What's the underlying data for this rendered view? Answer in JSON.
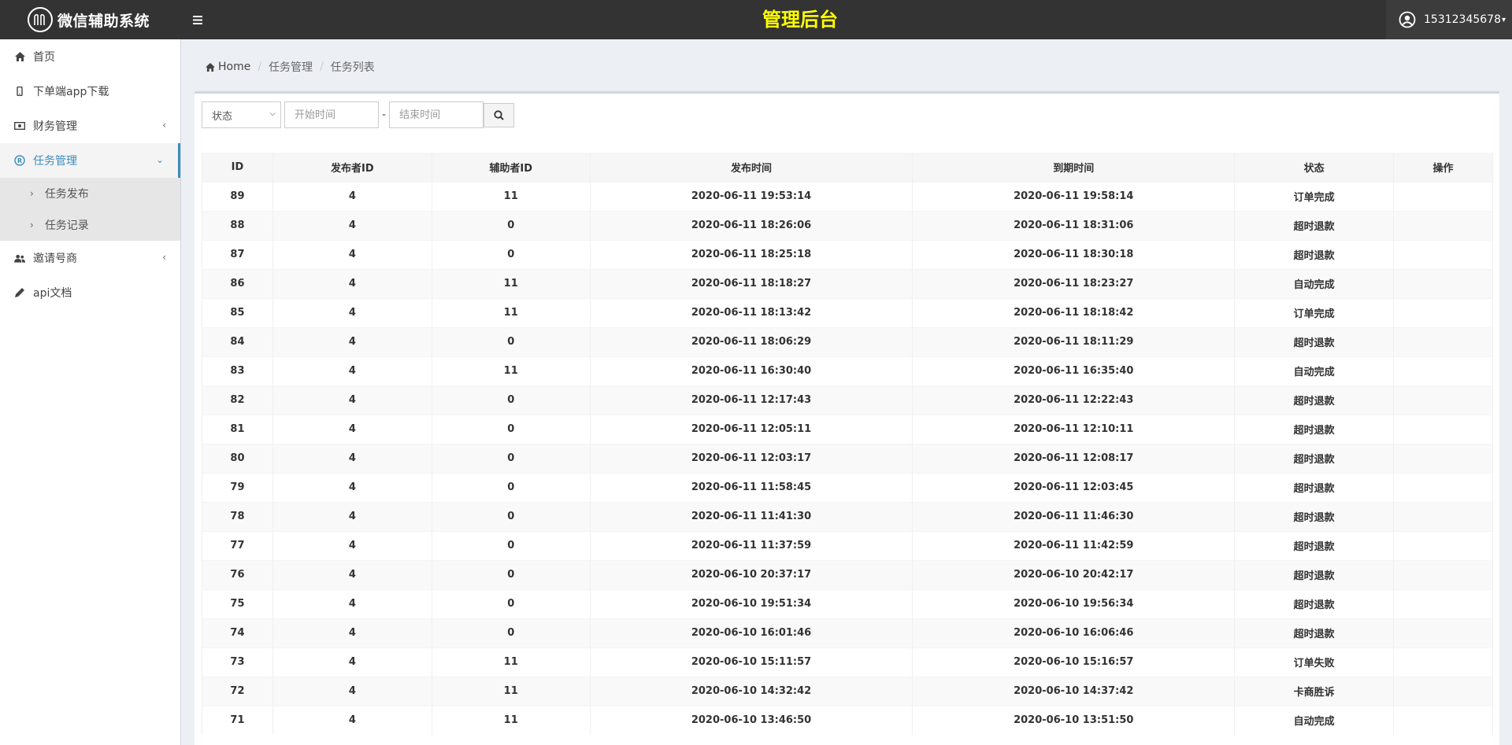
{
  "header": {
    "logo_text": "微信辅助系统",
    "title": "管理后台",
    "username": "15312345678"
  },
  "sidebar": {
    "items": [
      {
        "label": "首页",
        "icon": "home-icon"
      },
      {
        "label": "下单端app下载",
        "icon": "mobile-icon"
      },
      {
        "label": "财务管理",
        "icon": "money-icon",
        "expandable": true
      },
      {
        "label": "任务管理",
        "icon": "registered-icon",
        "expandable": true,
        "active": true,
        "children": [
          {
            "label": "任务发布"
          },
          {
            "label": "任务记录"
          }
        ]
      },
      {
        "label": "邀请号商",
        "icon": "users-icon",
        "expandable": true
      },
      {
        "label": "api文档",
        "icon": "pencil-icon"
      }
    ]
  },
  "breadcrumb": {
    "home": "Home",
    "items": [
      "任务管理",
      "任务列表"
    ]
  },
  "filter": {
    "status_label": "状态",
    "start_placeholder": "开始时间",
    "end_placeholder": "结束时间",
    "separator": "-"
  },
  "table": {
    "columns": [
      "ID",
      "发布者ID",
      "辅助者ID",
      "发布时间",
      "到期时间",
      "状态",
      "操作"
    ],
    "rows": [
      [
        "89",
        "4",
        "11",
        "2020-06-11 19:53:14",
        "2020-06-11 19:58:14",
        "订单完成",
        ""
      ],
      [
        "88",
        "4",
        "0",
        "2020-06-11 18:26:06",
        "2020-06-11 18:31:06",
        "超时退款",
        ""
      ],
      [
        "87",
        "4",
        "0",
        "2020-06-11 18:25:18",
        "2020-06-11 18:30:18",
        "超时退款",
        ""
      ],
      [
        "86",
        "4",
        "11",
        "2020-06-11 18:18:27",
        "2020-06-11 18:23:27",
        "自动完成",
        ""
      ],
      [
        "85",
        "4",
        "11",
        "2020-06-11 18:13:42",
        "2020-06-11 18:18:42",
        "订单完成",
        ""
      ],
      [
        "84",
        "4",
        "0",
        "2020-06-11 18:06:29",
        "2020-06-11 18:11:29",
        "超时退款",
        ""
      ],
      [
        "83",
        "4",
        "11",
        "2020-06-11 16:30:40",
        "2020-06-11 16:35:40",
        "自动完成",
        ""
      ],
      [
        "82",
        "4",
        "0",
        "2020-06-11 12:17:43",
        "2020-06-11 12:22:43",
        "超时退款",
        ""
      ],
      [
        "81",
        "4",
        "0",
        "2020-06-11 12:05:11",
        "2020-06-11 12:10:11",
        "超时退款",
        ""
      ],
      [
        "80",
        "4",
        "0",
        "2020-06-11 12:03:17",
        "2020-06-11 12:08:17",
        "超时退款",
        ""
      ],
      [
        "79",
        "4",
        "0",
        "2020-06-11 11:58:45",
        "2020-06-11 12:03:45",
        "超时退款",
        ""
      ],
      [
        "78",
        "4",
        "0",
        "2020-06-11 11:41:30",
        "2020-06-11 11:46:30",
        "超时退款",
        ""
      ],
      [
        "77",
        "4",
        "0",
        "2020-06-11 11:37:59",
        "2020-06-11 11:42:59",
        "超时退款",
        ""
      ],
      [
        "76",
        "4",
        "0",
        "2020-06-10 20:37:17",
        "2020-06-10 20:42:17",
        "超时退款",
        ""
      ],
      [
        "75",
        "4",
        "0",
        "2020-06-10 19:51:34",
        "2020-06-10 19:56:34",
        "超时退款",
        ""
      ],
      [
        "74",
        "4",
        "0",
        "2020-06-10 16:01:46",
        "2020-06-10 16:06:46",
        "超时退款",
        ""
      ],
      [
        "73",
        "4",
        "11",
        "2020-06-10 15:11:57",
        "2020-06-10 15:16:57",
        "订单失败",
        ""
      ],
      [
        "72",
        "4",
        "11",
        "2020-06-10 14:32:42",
        "2020-06-10 14:37:42",
        "卡商胜诉",
        ""
      ],
      [
        "71",
        "4",
        "11",
        "2020-06-10 13:46:50",
        "2020-06-10 13:51:50",
        "自动完成",
        ""
      ]
    ]
  },
  "colors": {
    "header_bg": "#333333",
    "title": "#ffff00",
    "accent": "#3c8dbc",
    "content_bg": "#ecf0f5"
  }
}
